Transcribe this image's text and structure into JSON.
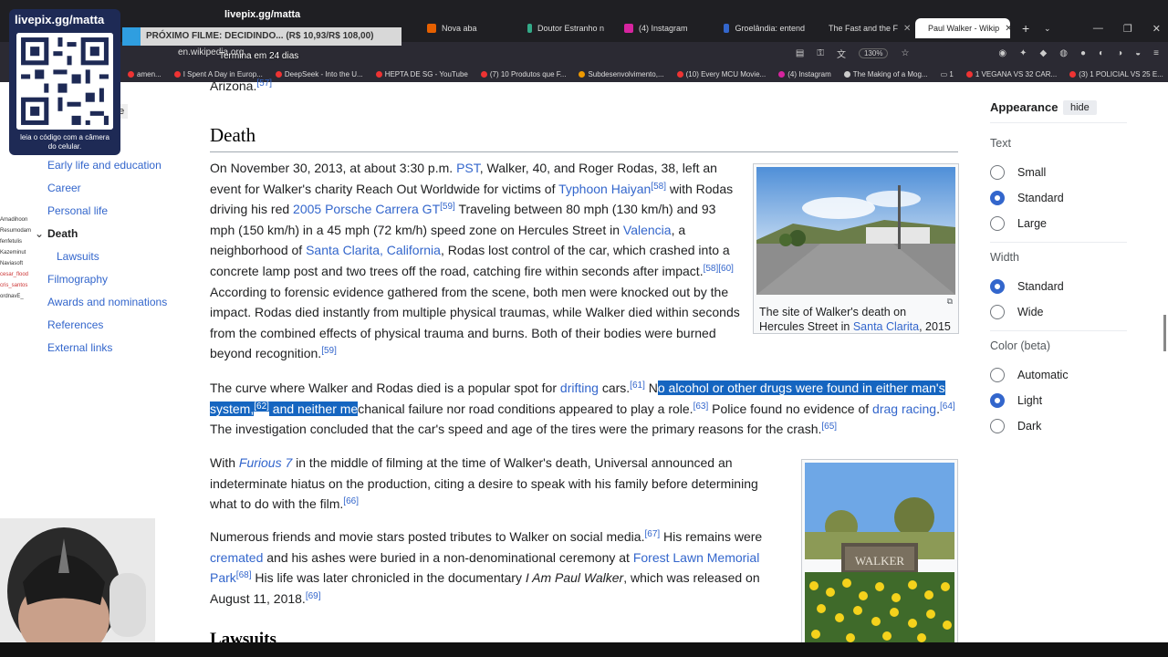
{
  "browser": {
    "tabs": [
      {
        "label": "Nova aba"
      },
      {
        "label": "Doutor Estranho n"
      },
      {
        "label": "(4) Instagram"
      },
      {
        "label": "Groelândia: entend"
      },
      {
        "label": "The Fast and the F"
      },
      {
        "label": "Paul Walker - Wikip"
      }
    ],
    "url": "en.wikipedia.org",
    "zoom": "130%",
    "bookmarks": [
      "amen...",
      "I Spent A Day in Europ...",
      "DeepSeek - Into the U...",
      "HEPTA DE SG - YouTube",
      "(7) 10 Produtos que F...",
      "Subdesenvolvimento,...",
      "(10) Every MCU Movie...",
      "(4) Instagram",
      "The Making of a Mog...",
      "1",
      "1 VEGANA VS 32 CAR...",
      "(3) 1 POLICIAL VS 25 E..."
    ]
  },
  "overlay": {
    "stream_title": "livepix.gg/matta",
    "qr_brand": "livepix.gg/matta",
    "qr_caption": "leia o código com a câmera do celular.",
    "movie_banner": "PRÓXIMO FILME: DECIDINDO... (R$ 10,93/R$ 108,00)",
    "ends": "Termina em 24 dias",
    "chat": [
      "Amadihoon",
      "Resumodam",
      "fenfetulis",
      "Kazeminut",
      "Naviasoft",
      "cesar_flood",
      "cris_santos",
      "ordnavE_"
    ]
  },
  "toc": {
    "hide_label": "de",
    "items": [
      "Early life and education",
      "Career",
      "Personal life",
      "Death",
      "Lawsuits",
      "Filmography",
      "Awards and nominations",
      "References",
      "External links"
    ],
    "current": "Death"
  },
  "article": {
    "prev_tail": "Arizona.",
    "prev_ref": "[57]",
    "heading": "Death",
    "p1": {
      "t1": "On November 30, 2013, at about 3:30 p.m. ",
      "l1": "PST",
      "t2": ", Walker, 40, and Roger Rodas, 38, left an event for Walker's charity Reach Out Worldwide for victims of ",
      "l2": "Typhoon Haiyan",
      "r1": "[58]",
      "t3": " with Rodas driving his red ",
      "l3": "2005 Porsche Carrera GT",
      "r2": "[59]",
      "t4": " Traveling between 80 mph (130 km/h) and 93 mph (150 km/h) in a 45 mph (72 km/h) speed zone on Hercules Street in ",
      "l4": "Valencia",
      "t5": ", a neighborhood of ",
      "l5": "Santa Clarita, California",
      "t6": ", Rodas lost control of the car, which crashed into a concrete lamp post and two trees off the road, catching fire within seconds after impact.",
      "r3": "[58][60]",
      "t7": " According to forensic evidence gathered from the scene, both men were knocked out by the impact. Rodas died instantly from multiple physical traumas, while Walker died within seconds from the combined effects of physical trauma and burns. Both of their bodies were burned beyond recognition.",
      "r4": "[59]"
    },
    "p2": {
      "t1": "The curve where Walker and Rodas died is a popular spot for ",
      "l1": "drifting",
      "t2": " cars.",
      "r1": "[61]",
      "t3": " N",
      "hl1": "o alcohol or other drugs were found in either man's system,",
      "r2": "[62]",
      "hl2": " and neither me",
      "t4": "chanical failure nor road conditions appeared to play a role.",
      "r3": "[63]",
      "t5": " Police found no evidence of ",
      "l2": "drag racing",
      "t6": ".",
      "r4": "[64]",
      "t7": " The investigation concluded that the car's speed and age of the tires were the primary reasons for the crash.",
      "r5": "[65]"
    },
    "p3": {
      "t1": "With ",
      "l1": "Furious 7",
      "t2": " in the middle of filming at the time of Walker's death, Universal announced an indeterminate hiatus on the production, citing a desire to speak with his family before determining what to do with the film.",
      "r1": "[66]"
    },
    "p4": {
      "t1": "Numerous friends and movie stars posted tributes to Walker on social media.",
      "r1": "[67]",
      "t2": " His remains were ",
      "l1": "cremated",
      "t3": " and his ashes were buried in a non-denominational ceremony at ",
      "l2": "Forest Lawn Memorial Park",
      "r2": "[68]",
      "t4": " His life was later chronicled in the documentary ",
      "i1": "I Am Paul Walker",
      "t5": ", which was released on August 11, 2018.",
      "r3": "[69]"
    },
    "next_heading": "Lawsuits",
    "fig1_caption_a": "The site of Walker's death on Hercules Street in ",
    "fig1_caption_link": "Santa Clarita",
    "fig1_caption_b": ", 2015",
    "fig2_sign": "WALKER"
  },
  "appearance": {
    "title": "Appearance",
    "hide": "hide",
    "text_label": "Text",
    "text_options": [
      "Small",
      "Standard",
      "Large"
    ],
    "text_selected": "Standard",
    "width_label": "Width",
    "width_options": [
      "Standard",
      "Wide"
    ],
    "width_selected": "Standard",
    "color_label": "Color (beta)",
    "color_options": [
      "Automatic",
      "Light",
      "Dark"
    ],
    "color_selected": "Light"
  },
  "colors": {
    "link": "#3366cc",
    "highlight": "#1565c0",
    "accent": "#3366cc"
  }
}
